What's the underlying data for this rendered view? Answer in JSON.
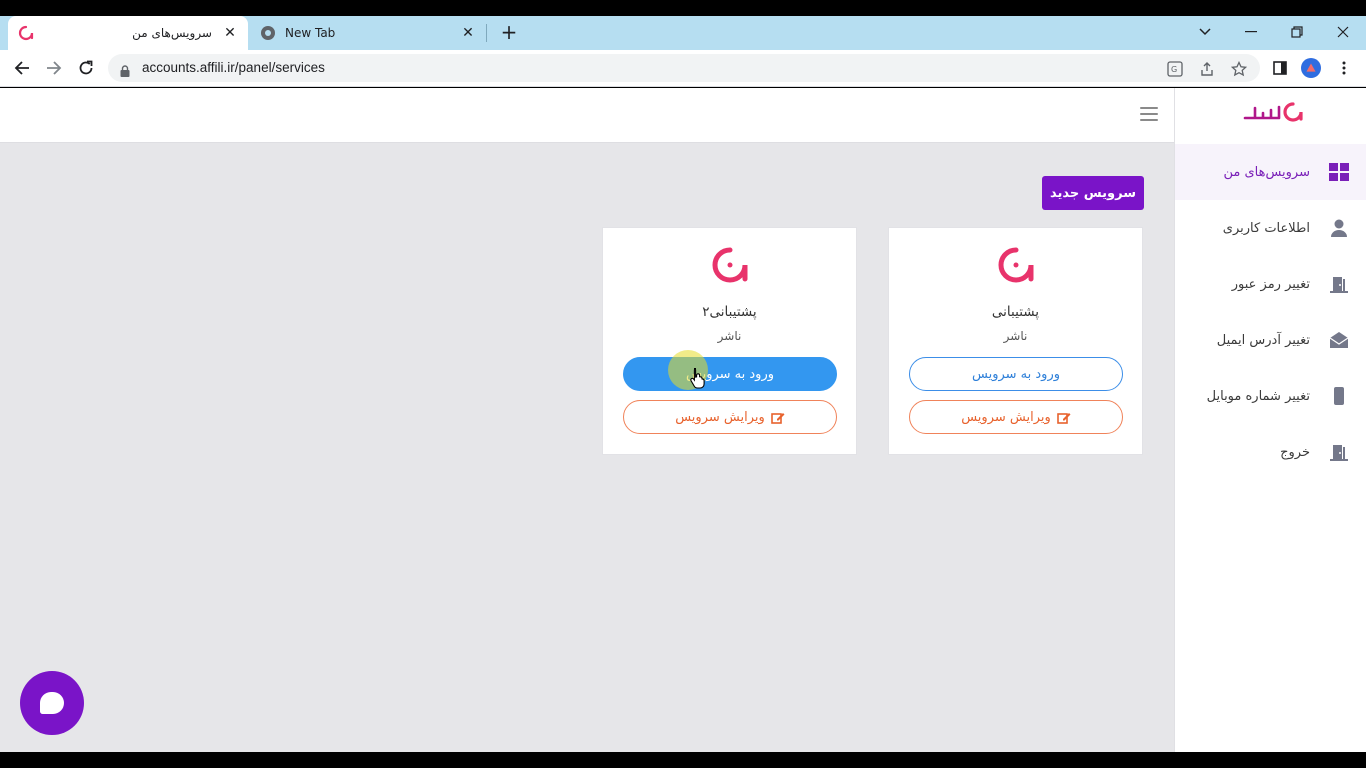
{
  "browser": {
    "tabs": [
      {
        "title": "سرویس‌های من",
        "active": true
      },
      {
        "title": "New Tab",
        "active": false
      }
    ],
    "url": "accounts.affili.ir/panel/services"
  },
  "brand": {
    "logo_text": "افیلی",
    "accent": "#7a14c8",
    "logo_color": "#e8336b"
  },
  "sidebar": {
    "items": [
      {
        "label": "سرویس‌های من",
        "icon": "grid-icon",
        "active": true
      },
      {
        "label": "اطلاعات کاربری",
        "icon": "user-icon",
        "active": false
      },
      {
        "label": "تغییر رمز عبور",
        "icon": "door-icon",
        "active": false
      },
      {
        "label": "تغییر آدرس ایمیل",
        "icon": "envelope-icon",
        "active": false
      },
      {
        "label": "تغییر شماره موبایل",
        "icon": "mobile-icon",
        "active": false
      },
      {
        "label": "خروج",
        "icon": "logout-door-icon",
        "active": false
      }
    ]
  },
  "main": {
    "new_service_label": "سرویس جدید",
    "cards": [
      {
        "name": "پشتیبانی",
        "role": "ناشر",
        "enter_label": "ورود به سرویس",
        "edit_label": "ویرایش سرویس"
      },
      {
        "name": "پشتیبانی۲",
        "role": "ناشر",
        "enter_label": "ورود به سرویس",
        "edit_label": "ویرایش سرویس"
      }
    ]
  }
}
